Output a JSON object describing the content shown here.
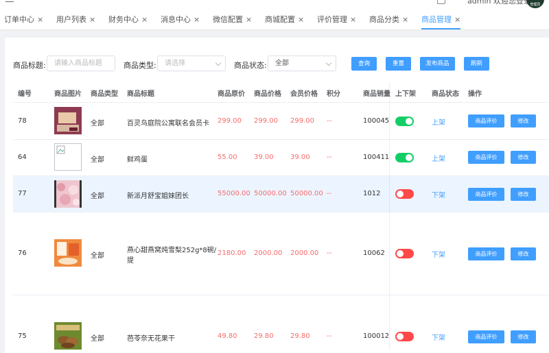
{
  "header": {
    "user_text": "admin 欢迎您登录",
    "avatar_text": "管理员"
  },
  "tabs": [
    {
      "label": "订单中心",
      "active": false
    },
    {
      "label": "用户列表",
      "active": false
    },
    {
      "label": "财务中心",
      "active": false
    },
    {
      "label": "消息中心",
      "active": false
    },
    {
      "label": "微信配置",
      "active": false
    },
    {
      "label": "商城配置",
      "active": false
    },
    {
      "label": "评价管理",
      "active": false
    },
    {
      "label": "商品分类",
      "active": false
    },
    {
      "label": "商品管理",
      "active": true
    }
  ],
  "tab_close": "×",
  "filters": {
    "title_label": "商品标题:",
    "title_placeholder": "请输入商品标题",
    "type_label": "商品类型:",
    "type_placeholder": "请选择",
    "status_label": "商品状态:",
    "status_value": "全部"
  },
  "buttons": {
    "search": "查询",
    "reset": "重置",
    "publish": "发布商品",
    "refresh": "刷新"
  },
  "columns": [
    "编号",
    "商品图片",
    "商品类型",
    "商品标题",
    "商品原价",
    "商品价格",
    "会员价格",
    "积分",
    "商品销量",
    "上下架",
    "商品状态",
    "操作"
  ],
  "rows": [
    {
      "id": "78",
      "type": "全部",
      "title": "百灵鸟庭院公寓联名会员卡",
      "title2": "",
      "orig": "299.00",
      "price": "299.00",
      "member": "299.00",
      "points": "--",
      "sales": "100045",
      "on": true,
      "status": "上架",
      "image": "card"
    },
    {
      "id": "64",
      "type": "全部",
      "title": "鲜鸡蛋",
      "title2": "",
      "orig": "55.00",
      "price": "39.00",
      "member": "39.00",
      "points": "--",
      "sales": "100411",
      "on": true,
      "status": "上架",
      "image": "broken"
    },
    {
      "id": "77",
      "type": "全部",
      "title": "新派月舒宝姐妹团长",
      "title2": "",
      "orig": "55000.00",
      "price": "50000.00",
      "member": "50000.00",
      "points": "--",
      "sales": "1012",
      "on": false,
      "status": "下架",
      "image": "pink"
    },
    {
      "id": "76",
      "type": "全部",
      "title": "燕心甜燕窝炖雪梨252g*8碗/",
      "title2": "提",
      "orig": "2180.00",
      "price": "2000.00",
      "member": "2000.00",
      "points": "--",
      "sales": "10062",
      "on": false,
      "status": "下架",
      "image": "orange"
    },
    {
      "id": "75",
      "type": "全部",
      "title": "芭苓奈无花果干",
      "title2": "",
      "orig": "49.80",
      "price": "29.80",
      "member": "29.80",
      "points": "--",
      "sales": "100012",
      "on": false,
      "status": "下架",
      "image": "fig"
    }
  ],
  "row_actions": {
    "review": "商品评价",
    "edit": "修改"
  },
  "colors": {
    "accent": "#409eff",
    "price_red": "#f56c6c",
    "switch_on": "#13ce66",
    "switch_off": "#ff4949"
  }
}
